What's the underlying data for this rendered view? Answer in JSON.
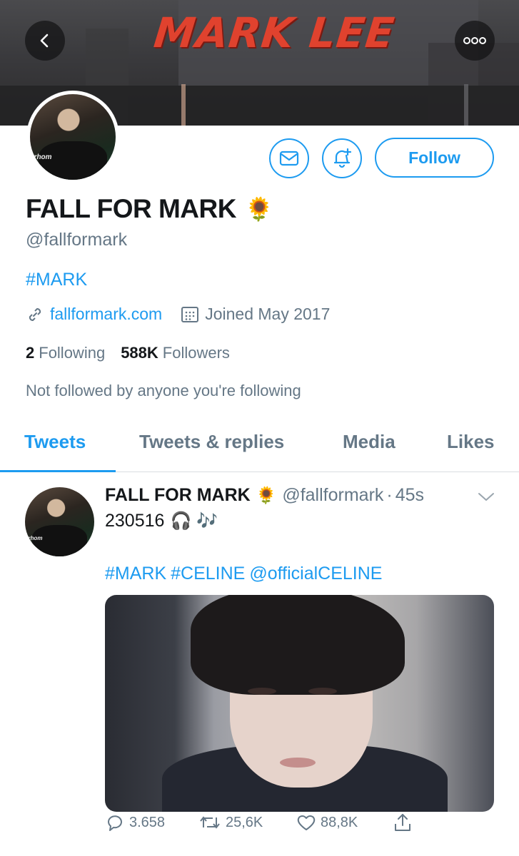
{
  "banner": {
    "title": "MARK LEE"
  },
  "header": {
    "back_icon": "chevron-left-icon",
    "more_icon": "more-horizontal-icon"
  },
  "profile": {
    "name": "FALL FOR MARK",
    "emoji": "🌻",
    "handle": "@fallformark",
    "bio": "#MARK",
    "website": "fallformark.com",
    "joined": "Joined May 2017",
    "following_count": "2",
    "following_label": "Following",
    "followers_count": "588K",
    "followers_label": "Followers",
    "not_followed": "Not followed by anyone you're following",
    "follow_label": "Follow",
    "avatar_text": "erhom"
  },
  "tabs": [
    {
      "label": "Tweets"
    },
    {
      "label": "Tweets & replies"
    },
    {
      "label": "Media"
    },
    {
      "label": "Likes"
    }
  ],
  "tweet": {
    "name": "FALL FOR MARK",
    "emoji": "🌻",
    "handle": "@fallformark",
    "separator": "·",
    "time": "45s",
    "text": "230516",
    "text_emoji": "🎧 🎶",
    "tags": [
      "#MARK",
      "#CELINE",
      "@officialCELINE"
    ],
    "replies": "3.658",
    "retweets": "25,6K",
    "likes": "88,8K"
  },
  "colors": {
    "accent": "#1d9bf0",
    "muted": "#657786",
    "text": "#14171a"
  }
}
